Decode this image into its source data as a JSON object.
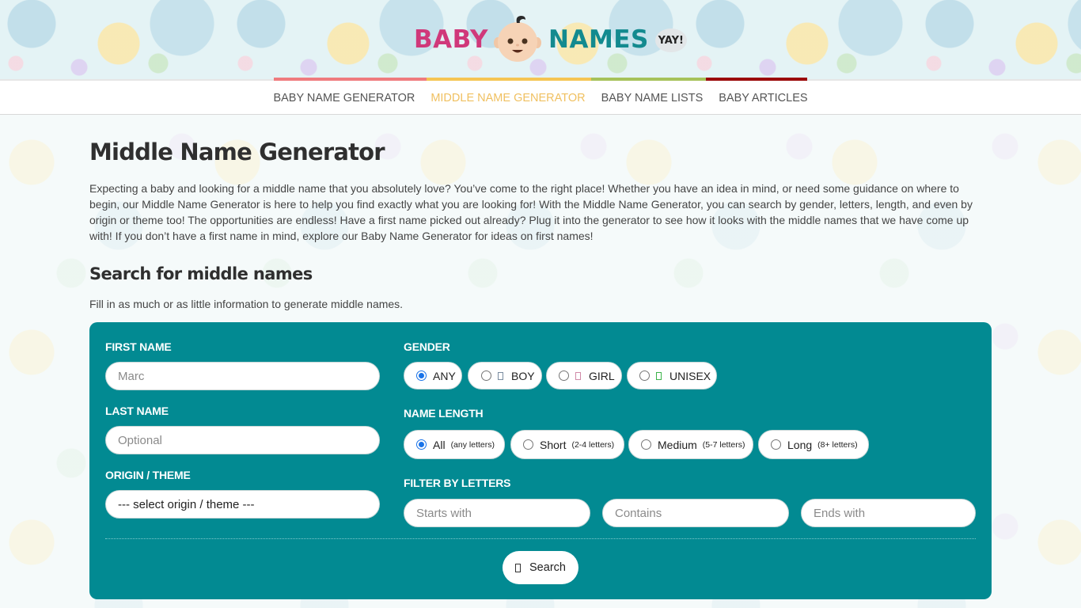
{
  "header": {
    "logo": {
      "word1": "BABY",
      "word2": "NAMES",
      "badge": "YAY!",
      "mascot_icon": "baby-face-icon",
      "colors": {
        "word1": "#d0387a",
        "word2": "#138a8f"
      }
    }
  },
  "nav": {
    "items": [
      {
        "label": "BABY NAME GENERATOR",
        "stripe_color": "#ef7b7e",
        "active": false
      },
      {
        "label": "MIDDLE NAME GENERATOR",
        "stripe_color": "#f5c553",
        "active": true
      },
      {
        "label": "BABY NAME LISTS",
        "stripe_color": "#a6c25a",
        "active": false
      },
      {
        "label": "BABY ARTICLES",
        "stripe_color": "#9b0a0a",
        "active": false
      }
    ],
    "active_color": "#f0c060"
  },
  "page": {
    "title": "Middle Name Generator",
    "intro": "Expecting a baby and looking for a middle name that you absolutely love? You’ve come to the right place! Whether you have an idea in mind, or need some guidance on where to begin, our Middle Name Generator is here to help you find exactly what you are looking for! With the Middle Name Generator, you can search by gender, letters, length, and even by origin or theme too! The opportunities are endless! Have a first name picked out already? Plug it into the generator to see how it looks with the middle names that we have come up with! If you don’t have a first name in mind, explore our Baby Name Generator for ideas on first names!",
    "section_title": "Search for middle names",
    "hint": "Fill in as much or as little information to generate middle names."
  },
  "form": {
    "panel_color": "#028a92",
    "first_name": {
      "label": "FIRST NAME",
      "value": "",
      "placeholder": "Marc"
    },
    "last_name": {
      "label": "LAST NAME",
      "value": "",
      "placeholder": "Optional"
    },
    "origin": {
      "label": "ORIGIN / THEME",
      "selected": "--- select origin / theme ---"
    },
    "gender": {
      "label": "GENDER",
      "options": [
        {
          "label": "ANY",
          "icon": "",
          "checked": true
        },
        {
          "label": "BOY",
          "icon": "boy-icon",
          "icon_color": "#7a8ca0",
          "checked": false
        },
        {
          "label": "GIRL",
          "icon": "girl-icon",
          "icon_color": "#d08aa8",
          "checked": false
        },
        {
          "label": "UNISEX",
          "icon": "unisex-icon",
          "icon_color": "#3cb34a",
          "checked": false
        }
      ]
    },
    "name_length": {
      "label": "NAME LENGTH",
      "options": [
        {
          "label": "All",
          "sub": "(any letters)",
          "checked": true
        },
        {
          "label": "Short",
          "sub": "(2-4 letters)",
          "checked": false
        },
        {
          "label": "Medium",
          "sub": "(5-7 letters)",
          "checked": false
        },
        {
          "label": "Long",
          "sub": "(8+ letters)",
          "checked": false
        }
      ]
    },
    "filter": {
      "label": "FILTER BY LETTERS",
      "starts_with": {
        "placeholder": "Starts with",
        "value": ""
      },
      "contains": {
        "placeholder": "Contains",
        "value": ""
      },
      "ends_with": {
        "placeholder": "Ends with",
        "value": ""
      }
    },
    "search_button": {
      "label": "Search",
      "icon": "search-icon"
    }
  }
}
